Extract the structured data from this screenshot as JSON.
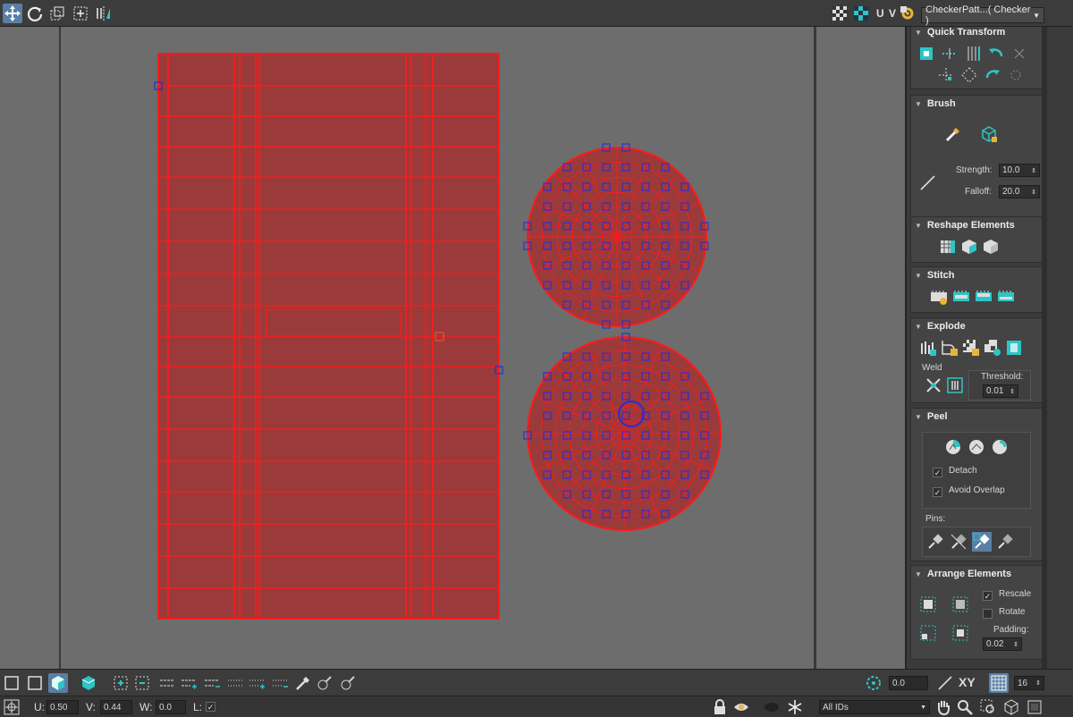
{
  "toolbar": {
    "uv_label": "U V",
    "checker_pattern": "CheckerPatt...( Checker )"
  },
  "rollouts": {
    "quick_transform": "Quick Transform",
    "brush": "Brush",
    "brush_strength_label": "Strength:",
    "brush_strength_value": "10.0",
    "brush_falloff_label": "Falloff:",
    "brush_falloff_value": "20.0",
    "reshape_elements": "Reshape Elements",
    "stitch": "Stitch",
    "explode": "Explode",
    "weld_label": "Weld",
    "threshold_label": "Threshold:",
    "threshold_value": "0.01",
    "peel": "Peel",
    "detach_label": "Detach",
    "avoid_overlap_label": "Avoid Overlap",
    "pins_label": "Pins:",
    "arrange_elements": "Arrange Elements",
    "rescale_label": "Rescale",
    "rotate_label": "Rotate",
    "padding_label": "Padding:",
    "padding_value": "0.02"
  },
  "statusbar": {
    "u_label": "U:",
    "u_value": "0.50",
    "v_label": "V:",
    "v_value": "0.44",
    "w_label": "W:",
    "w_value": "0.0",
    "l_label": "L:",
    "angle_value": "0.0",
    "xy_label": "XY",
    "grid_value": "16",
    "id_filter": "All IDs"
  },
  "colors": {
    "uv_fill": "#9b3a3a",
    "uv_edge": "#ff1a1a",
    "vertex": "#2b2bd6",
    "viewport_bg": "#6d6d6d",
    "accent": "#2fc4c4"
  }
}
